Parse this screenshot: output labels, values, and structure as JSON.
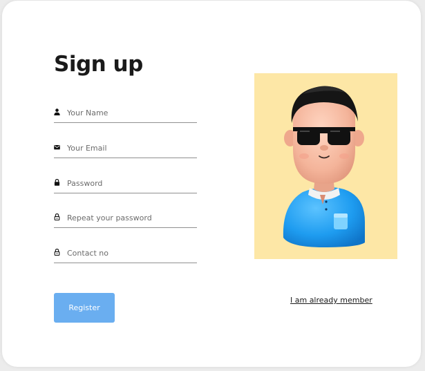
{
  "form": {
    "title": "Sign up",
    "fields": [
      {
        "name": "name",
        "icon": "person-icon",
        "placeholder": "Your Name",
        "value": ""
      },
      {
        "name": "email",
        "icon": "mail-icon",
        "placeholder": "Your Email",
        "value": ""
      },
      {
        "name": "password",
        "icon": "lock-icon",
        "placeholder": "Password",
        "value": ""
      },
      {
        "name": "repeat-password",
        "icon": "lock-outline-icon",
        "placeholder": "Repeat your password",
        "value": ""
      },
      {
        "name": "contact",
        "icon": "lock-outline-icon",
        "placeholder": "Contact no",
        "value": ""
      }
    ],
    "register_label": "Register",
    "member_link": "I am already member"
  },
  "colors": {
    "accent": "#6aaef0",
    "panel_background": "#fde7a6",
    "shirt": "#2aa3f0",
    "text": "#1a1a1a"
  }
}
